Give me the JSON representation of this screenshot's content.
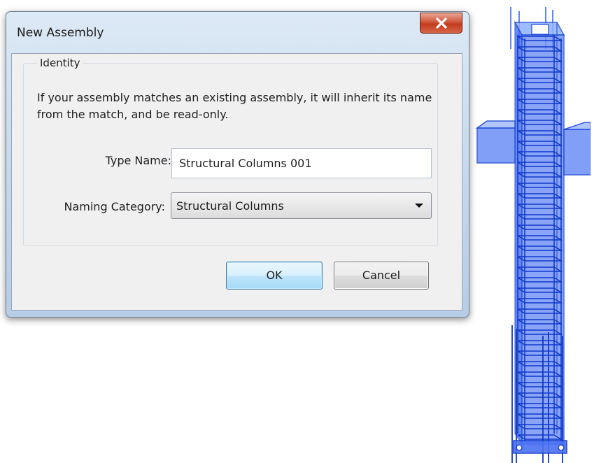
{
  "dialog": {
    "title": "New Assembly",
    "close_icon": "close-x-icon",
    "group_title": "Identity",
    "message": "If your assembly matches an existing assembly, it will inherit its name from the match, and be read-only.",
    "type_name_label": "Type Name:",
    "type_name_value": "Structural Columns 001",
    "naming_category_label": "Naming Category:",
    "naming_category_value": "Structural Columns",
    "ok_label": "OK",
    "cancel_label": "Cancel"
  },
  "viewport": {
    "object": "structural-column-3d-view",
    "color": "#2a5cf0"
  },
  "colors": {
    "close_button": "#c8452a",
    "ok_border": "#3c7fb1"
  }
}
